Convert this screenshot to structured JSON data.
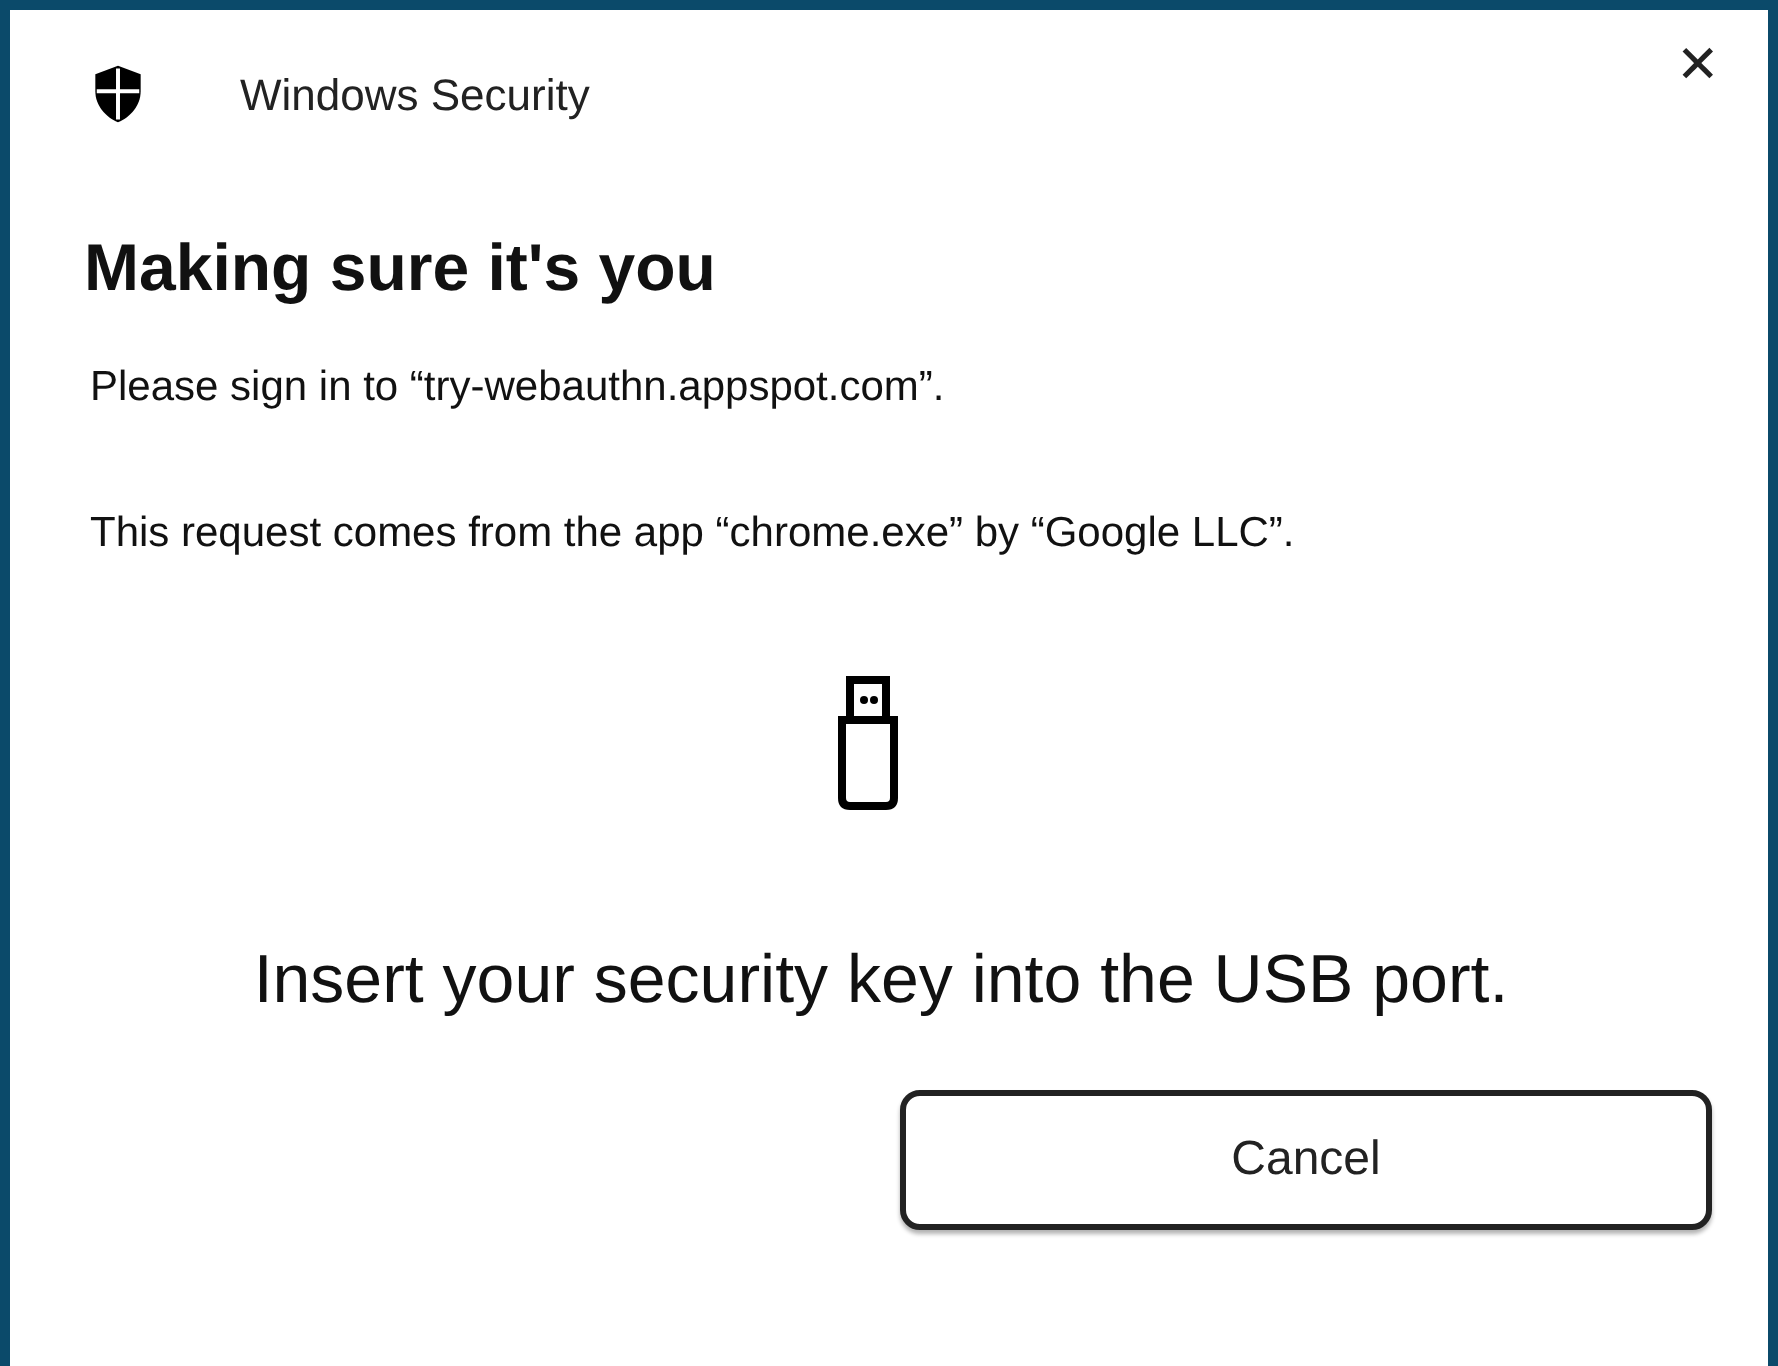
{
  "window": {
    "title": "Windows Security",
    "close": "✕"
  },
  "heading": "Making sure it's you",
  "messages": [
    "Please sign in to “try-webauthn.appspot.com”.",
    "This request comes from the app “chrome.exe” by “Google LLC”."
  ],
  "instruction": "Insert your security key into the USB port.",
  "buttons": [
    {
      "label": "Cancel"
    }
  ]
}
